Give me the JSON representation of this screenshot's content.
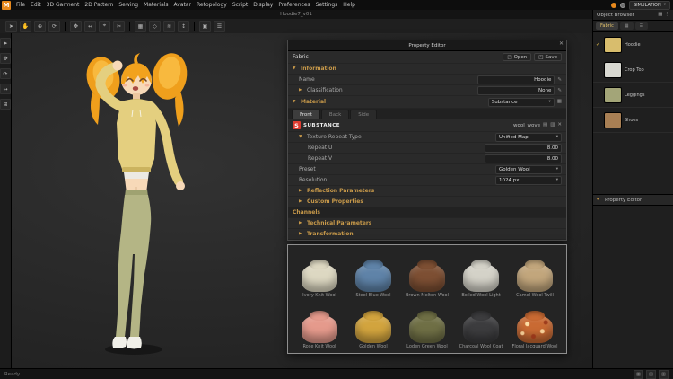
{
  "app": {
    "logo_letter": "M",
    "title": "Hoodie7_v01"
  },
  "icons": {
    "pencil": "✎",
    "close": "✕",
    "caret": "▾",
    "expanded": "▼",
    "collapsed": "▶",
    "open_glyph": "◰",
    "save_glyph": "◳",
    "copy_glyph": "▤",
    "link_glyph": "▥",
    "delete_glyph": "✕",
    "grid_glyph": "▦",
    "menu_glyph": "☰",
    "dots_glyph": "⋮"
  },
  "menubar": {
    "items": [
      "File",
      "Edit",
      "3D Garment",
      "2D Pattern",
      "Sewing",
      "Materials",
      "Avatar",
      "Retopology",
      "Script",
      "Display",
      "Preferences",
      "Settings",
      "Help"
    ]
  },
  "topright": {
    "simulation_label": "SIMULATION"
  },
  "toolbar": {
    "icons": [
      {
        "name": "select",
        "glyph": "➤"
      },
      {
        "name": "pan",
        "glyph": "✋"
      },
      {
        "name": "zoom",
        "glyph": "⊕"
      },
      {
        "name": "rotate-view",
        "glyph": "⟳"
      },
      {
        "name": "move",
        "glyph": "✥"
      },
      {
        "name": "scale",
        "glyph": "↔"
      },
      {
        "name": "pin",
        "glyph": "⌖"
      },
      {
        "name": "scissors",
        "glyph": "✂"
      },
      {
        "name": "grid",
        "glyph": "▦"
      },
      {
        "name": "pattern",
        "glyph": "◇"
      },
      {
        "name": "sewing",
        "glyph": "≋"
      },
      {
        "name": "measure",
        "glyph": "↕"
      },
      {
        "name": "layers",
        "glyph": "▣"
      },
      {
        "name": "options",
        "glyph": "☰"
      }
    ]
  },
  "left_toolbar": {
    "icons": [
      {
        "name": "cursor",
        "glyph": "➤"
      },
      {
        "name": "move-gizmo",
        "glyph": "✥"
      },
      {
        "name": "rotate-gizmo",
        "glyph": "⟳"
      },
      {
        "name": "scale-gizmo",
        "glyph": "↔"
      },
      {
        "name": "frame-all",
        "glyph": "⊞"
      }
    ]
  },
  "property_editor": {
    "title": "Property Editor",
    "fabric_label": "Fabric",
    "open_label": "Open",
    "save_label": "Save",
    "information_label": "Information",
    "name_label": "Name",
    "name_value": "Hoodie",
    "classification_label": "Classification",
    "classification_value": "None",
    "material_label": "Material",
    "material_type": "Substance",
    "tabs": [
      {
        "label": "Front"
      },
      {
        "label": "Back"
      },
      {
        "label": "Side"
      }
    ],
    "substance_logo_letter": "S",
    "substance_brand": "SUBSTANCE",
    "substance_file": "wool_wove",
    "texture_repeat_label": "Texture Repeat Type",
    "texture_repeat_value": "Unified Map",
    "repeat_u_label": "Repeat U",
    "repeat_u_value": "8.00",
    "repeat_v_label": "Repeat V",
    "repeat_v_value": "8.00",
    "preset_label": "Preset",
    "preset_value": "Golden Wool",
    "resolution_label": "Resolution",
    "resolution_value": "1024 px",
    "reflection_label": "Reflection Parameters",
    "custom_properties_label": "Custom Properties",
    "channels_label": "Channels",
    "technical_label": "Technical Parameters",
    "transformation_label": "Transformation"
  },
  "material_library": {
    "items": [
      {
        "name": "Ivory Knit Wool",
        "color": "#ddd8c2"
      },
      {
        "name": "Steel Blue Wool",
        "color": "#5f83a8"
      },
      {
        "name": "Brown Melton Wool",
        "color": "#7d4f33"
      },
      {
        "name": "Boiled Wool Light",
        "color": "#d4d2c8"
      },
      {
        "name": "Camel Wool Twill",
        "color": "#c2a67c"
      },
      {
        "name": "Rose Knit Wool",
        "color": "#e59a8c"
      },
      {
        "name": "Golden Wool",
        "color": "#d2a43e"
      },
      {
        "name": "Loden Green Wool",
        "color": "#6f6f45"
      },
      {
        "name": "Charcoal Wool Coat",
        "color": "#3c3c3e"
      },
      {
        "name": "Floral Jacquard Wool",
        "color": "#c96a33"
      }
    ]
  },
  "object_browser": {
    "title": "Object Browser",
    "tab_label": "Fabric",
    "items": [
      {
        "name": "Hoodie",
        "color": "#d8bd6d",
        "check": "✓"
      },
      {
        "name": "Crop Top",
        "color": "#d9d9d2",
        "check": ""
      },
      {
        "name": "Leggings",
        "color": "#a3a578",
        "check": ""
      },
      {
        "name": "Shoes",
        "color": "#a87f54",
        "check": ""
      }
    ],
    "collapsed_panel_title": "Property Editor"
  },
  "statusbar": {
    "left": "Ready"
  }
}
